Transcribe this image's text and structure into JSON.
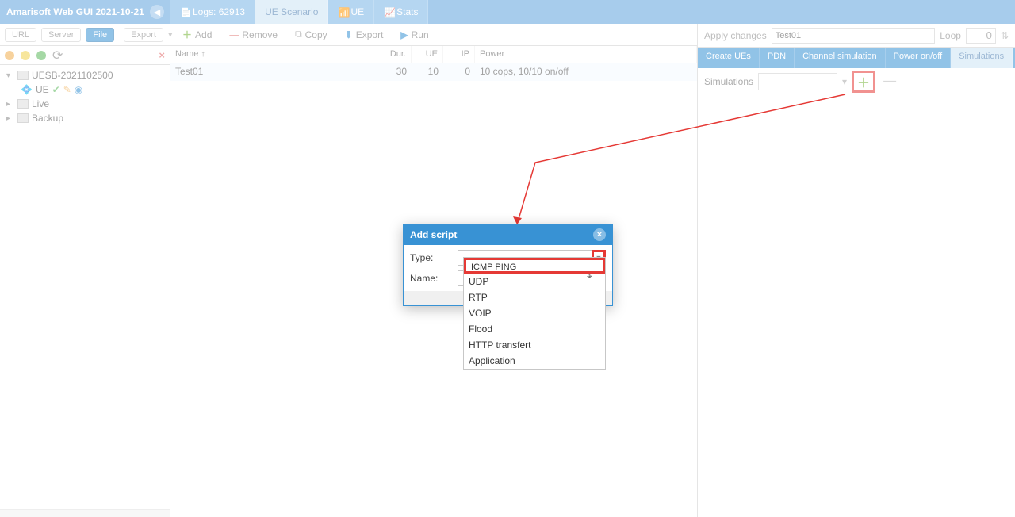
{
  "titlebar": {
    "title": "Amarisoft Web GUI 2021-10-21"
  },
  "tabs": [
    {
      "label": "Logs: 62913"
    },
    {
      "label": "UE Scenario",
      "active": true
    },
    {
      "label": "UE"
    },
    {
      "label": "Stats"
    }
  ],
  "left": {
    "buttons": {
      "url": "URL",
      "server": "Server",
      "file": "File",
      "export": "Export"
    },
    "tree": {
      "root": "UESB-2021102500",
      "ue": "UE",
      "live": "Live",
      "backup": "Backup"
    }
  },
  "center": {
    "toolbar": {
      "add": "Add",
      "remove": "Remove",
      "copy": "Copy",
      "export": "Export",
      "run": "Run"
    },
    "headers": {
      "name": "Name ↑",
      "dur": "Dur.",
      "ue": "UE",
      "ip": "IP",
      "power": "Power"
    },
    "row": {
      "name": "Test01",
      "dur": "30",
      "ue": "10",
      "ip": "0",
      "power": "10 cops, 10/10 on/off"
    }
  },
  "right": {
    "apply": "Apply changes",
    "selected": "Test01",
    "loop_label": "Loop",
    "loop_value": "0",
    "tabs": {
      "create": "Create UEs",
      "pdn": "PDN",
      "channel": "Channel simulation",
      "power": "Power on/off",
      "sim": "Simulations"
    },
    "sim_label": "Simulations"
  },
  "dialog": {
    "title": "Add script",
    "type_label": "Type:",
    "name_label": "Name:",
    "options": [
      "ICMP PING",
      "UDP",
      "RTP",
      "VOIP",
      "Flood",
      "HTTP transfert",
      "Application"
    ]
  }
}
